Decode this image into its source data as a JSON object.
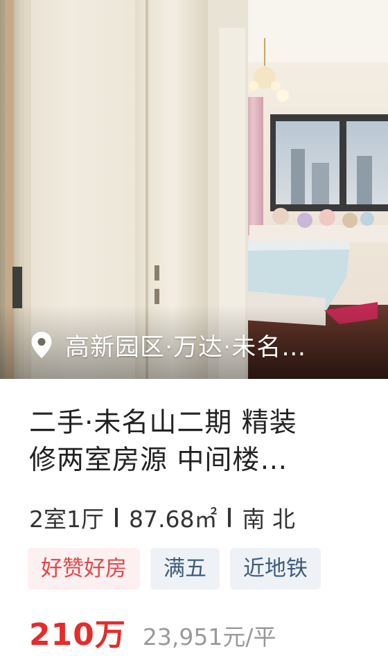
{
  "listing": {
    "location": "高新园区·万达·未名…",
    "title_line1": "二手·未名山二期 精装",
    "title_line2": "修两室房源 中间楼…",
    "specs": {
      "layout": "2室1厅",
      "area": "87.68㎡",
      "orientation": "南 北"
    },
    "tags": [
      {
        "label": "好赞好房",
        "style": "red"
      },
      {
        "label": "满五",
        "style": "blue"
      },
      {
        "label": "近地铁",
        "style": "blue"
      }
    ],
    "price": "210万",
    "unit_price": "23,951元/平"
  },
  "icons": {
    "location": "location-pin-icon"
  },
  "colors": {
    "price": "#e62b2b",
    "tag_red_bg": "#fdf0f0",
    "tag_red_text": "#e2484a",
    "tag_blue_bg": "#eef2f6",
    "tag_blue_text": "#3f5c7e",
    "muted": "#999999"
  }
}
